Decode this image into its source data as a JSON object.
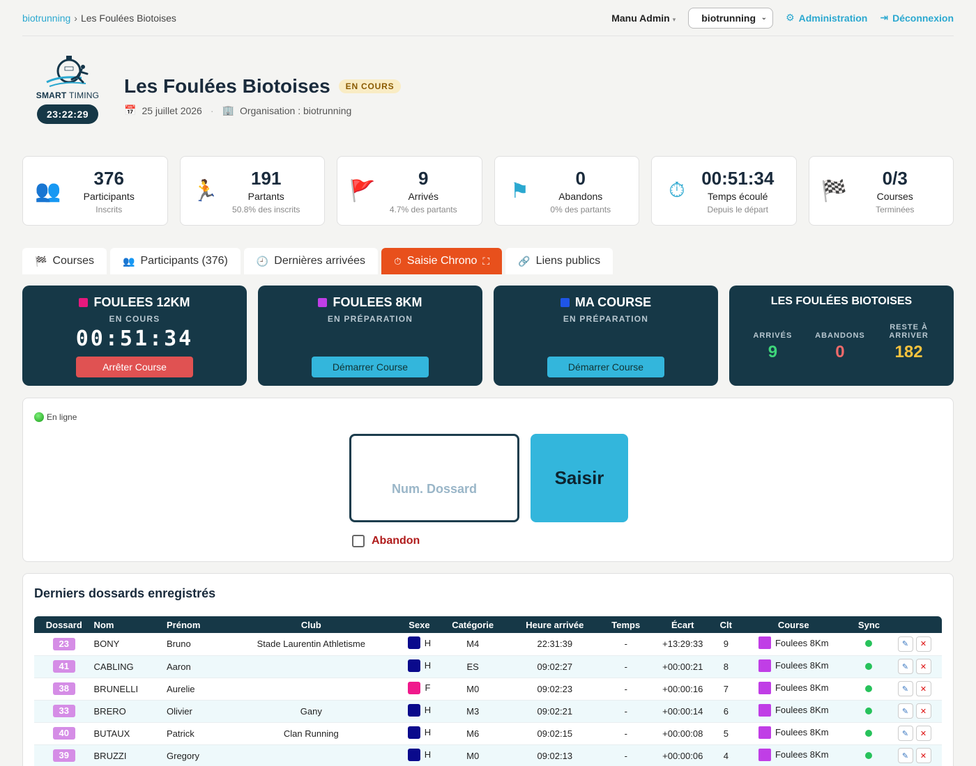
{
  "breadcrumb": {
    "root": "biotrunning",
    "separator": "›",
    "current": "Les Foulées Biotoises"
  },
  "topbar": {
    "user": "Manu Admin",
    "org_select": "biotrunning",
    "admin_link": "Administration",
    "logout_link": "Déconnexion"
  },
  "logo": {
    "brand_bold": "SMART",
    "brand_light": "TIMING",
    "clock": "23:22:29"
  },
  "event": {
    "title": "Les Foulées Biotoises",
    "status": "EN COURS",
    "date": "25 juillet 2026",
    "organisation": "Organisation : biotrunning"
  },
  "stats": [
    {
      "icon": "👥",
      "value": "376",
      "label": "Participants",
      "sub": "Inscrits"
    },
    {
      "icon": "🏃",
      "value": "191",
      "label": "Partants",
      "sub": "50.8% des inscrits"
    },
    {
      "icon": "🚩",
      "value": "9",
      "label": "Arrivés",
      "sub": "4.7% des partants"
    },
    {
      "icon": "⚑",
      "value": "0",
      "label": "Abandons",
      "sub": "0% des partants"
    },
    {
      "icon": "⏱",
      "value": "00:51:34",
      "label": "Temps écoulé",
      "sub": "Depuis le départ"
    },
    {
      "icon": "🏁",
      "value": "0/3",
      "label": "Courses",
      "sub": "Terminées"
    }
  ],
  "tabs": [
    {
      "icon": "🏁",
      "label": "Courses"
    },
    {
      "icon": "👥",
      "label": "Participants (376)"
    },
    {
      "icon": "🕘",
      "label": "Dernières arrivées"
    },
    {
      "icon": "⏱",
      "label": "Saisie Chrono",
      "suffix": "⛶"
    },
    {
      "icon": "🔗",
      "label": "Liens publics"
    }
  ],
  "races": [
    {
      "name": "FOULEES 12KM",
      "color": "#e6197d",
      "status": "EN COURS",
      "timer": "00:51:34",
      "button": "Arrêter Course"
    },
    {
      "name": "FOULEES 8KM",
      "color": "#c03ee6",
      "status": "EN PRÉPARATION",
      "timer": "",
      "button": "Démarrer Course"
    },
    {
      "name": "MA COURSE",
      "color": "#1f55e6",
      "status": "EN PRÉPARATION",
      "timer": "",
      "button": "Démarrer Course"
    }
  ],
  "summary": {
    "title": "LES FOULÉES BIOTOISES",
    "arrived_label": "ARRIVÉS",
    "arrived": "9",
    "abandons_label": "ABANDONS",
    "abandons": "0",
    "remaining_label": "RESTE À ARRIVER",
    "remaining": "182",
    "colors": {
      "arrived": "#3ed67a",
      "abandons": "#f06a6a",
      "remaining": "#f6c23e"
    }
  },
  "entry": {
    "status": "En ligne",
    "placeholder": "Num. Dossard",
    "submit": "Saisir",
    "abandon_label": "Abandon"
  },
  "table": {
    "title": "Derniers dossards enregistrés",
    "headers": [
      "Dossard",
      "Nom",
      "Prénom",
      "Club",
      "Sexe",
      "Catégorie",
      "Heure arrivée",
      "Temps",
      "Écart",
      "Clt",
      "Course",
      "Sync",
      ""
    ],
    "rows": [
      {
        "bib": "23",
        "nom": "BONY",
        "prenom": "Bruno",
        "club": "Stade Laurentin Athletisme",
        "sexe": "H",
        "sexe_color": "#0a0a8c",
        "cat": "M4",
        "heure": "22:31:39",
        "temps": "-",
        "ecart": "+13:29:33",
        "clt": "9",
        "course": "Foulees 8Km"
      },
      {
        "bib": "41",
        "nom": "CABLING",
        "prenom": "Aaron",
        "club": "",
        "sexe": "H",
        "sexe_color": "#0a0a8c",
        "cat": "ES",
        "heure": "09:02:27",
        "temps": "-",
        "ecart": "+00:00:21",
        "clt": "8",
        "course": "Foulees 8Km"
      },
      {
        "bib": "38",
        "nom": "BRUNELLI",
        "prenom": "Aurelie",
        "club": "",
        "sexe": "F",
        "sexe_color": "#f0198c",
        "cat": "M0",
        "heure": "09:02:23",
        "temps": "-",
        "ecart": "+00:00:16",
        "clt": "7",
        "course": "Foulees 8Km"
      },
      {
        "bib": "33",
        "nom": "BRERO",
        "prenom": "Olivier",
        "club": "Gany",
        "sexe": "H",
        "sexe_color": "#0a0a8c",
        "cat": "M3",
        "heure": "09:02:21",
        "temps": "-",
        "ecart": "+00:00:14",
        "clt": "6",
        "course": "Foulees 8Km"
      },
      {
        "bib": "40",
        "nom": "BUTAUX",
        "prenom": "Patrick",
        "club": "Clan Running",
        "sexe": "H",
        "sexe_color": "#0a0a8c",
        "cat": "M6",
        "heure": "09:02:15",
        "temps": "-",
        "ecart": "+00:00:08",
        "clt": "5",
        "course": "Foulees 8Km"
      },
      {
        "bib": "39",
        "nom": "BRUZZI",
        "prenom": "Gregory",
        "club": "",
        "sexe": "H",
        "sexe_color": "#0a0a8c",
        "cat": "M0",
        "heure": "09:02:13",
        "temps": "-",
        "ecart": "+00:00:06",
        "clt": "4",
        "course": "Foulees 8Km"
      }
    ]
  },
  "icons": {
    "admin": "gear-icon",
    "logout": "logout-icon",
    "calendar": "calendar-icon",
    "building": "building-icon",
    "edit": "edit-icon",
    "delete": "delete-icon"
  }
}
